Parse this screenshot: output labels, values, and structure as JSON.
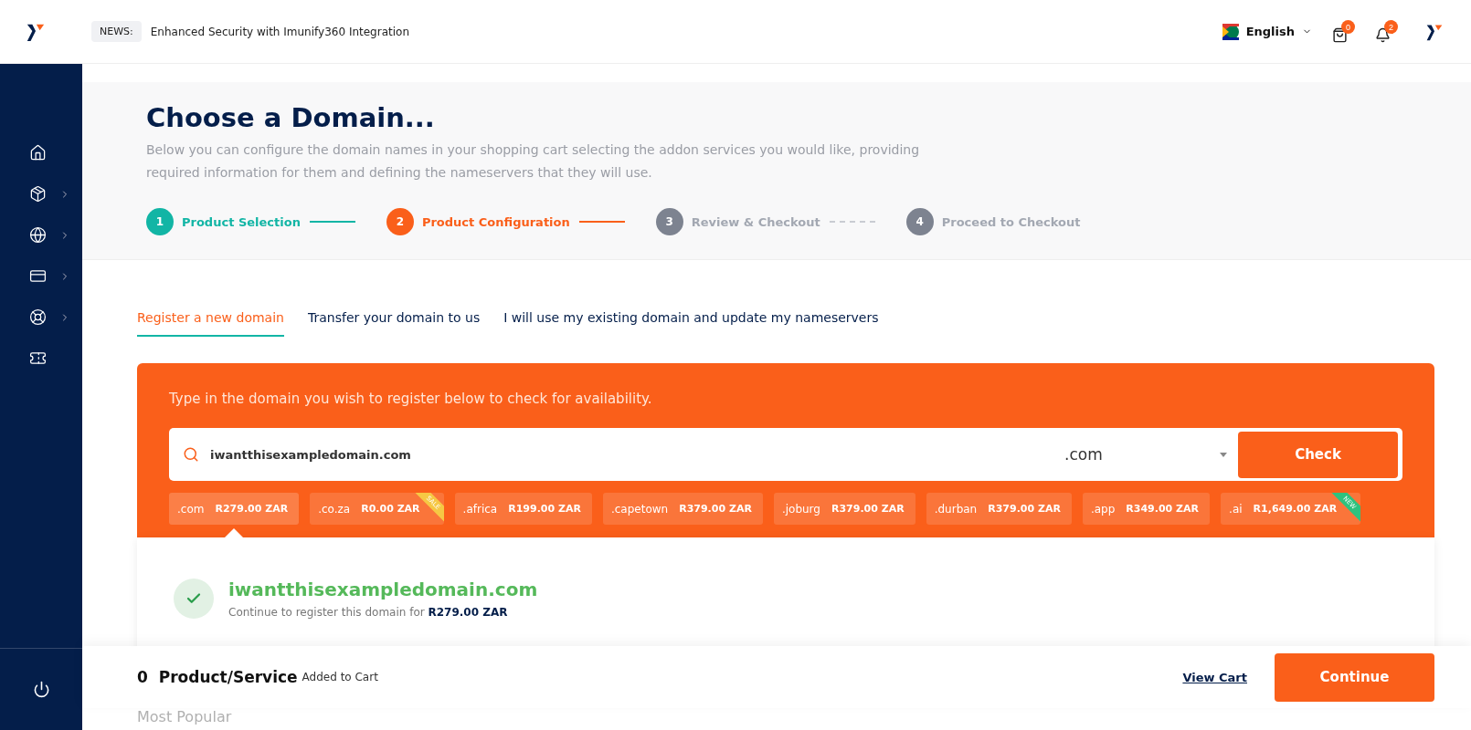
{
  "header": {
    "news_label": "NEWS:",
    "news_text": "Enhanced Security with Imunify360 Integration",
    "language": "English",
    "cart_count": "0",
    "notification_count": "2"
  },
  "sidebar": {
    "items": [
      {
        "kind": "home",
        "expandable": false
      },
      {
        "kind": "box",
        "expandable": true
      },
      {
        "kind": "globe",
        "expandable": true
      },
      {
        "kind": "card",
        "expandable": true
      },
      {
        "kind": "support",
        "expandable": true
      },
      {
        "kind": "ticket",
        "expandable": false
      }
    ]
  },
  "title": "Choose a Domain...",
  "description": "Below you can configure the domain names in your shopping cart selecting the addon services you would like, providing required information for them and defining the nameservers that they will use.",
  "steps": [
    {
      "number": "1",
      "label": "Product Selection",
      "completed": true,
      "active": false
    },
    {
      "number": "2",
      "label": "Product Configuration",
      "completed": false,
      "active": true
    },
    {
      "number": "3",
      "label": "Review & Checkout",
      "completed": false,
      "active": false
    },
    {
      "number": "4",
      "label": "Proceed to Checkout",
      "completed": false,
      "active": false
    }
  ],
  "tabs": [
    {
      "label": "Register a new domain",
      "selected": true
    },
    {
      "label": "Transfer your domain to us",
      "selected": false
    },
    {
      "label": "I will use my existing domain and update my nameservers",
      "selected": false
    }
  ],
  "search": {
    "prompt": "Type in the domain you wish to register below to check for availability.",
    "value": "iwantthisexampledomain.com",
    "tld": ".com",
    "button": "Check"
  },
  "tlds": [
    {
      "name": ".com",
      "price": "R279.00 ZAR",
      "selected": true
    },
    {
      "name": ".co.za",
      "price": "R0.00 ZAR",
      "selected": false,
      "ribbon": {
        "text": "SALE",
        "color": "#f6c844"
      }
    },
    {
      "name": ".africa",
      "price": "R199.00 ZAR",
      "selected": false
    },
    {
      "name": ".capetown",
      "price": "R379.00 ZAR",
      "selected": false
    },
    {
      "name": ".joburg",
      "price": "R379.00 ZAR",
      "selected": false
    },
    {
      "name": ".durban",
      "price": "R379.00 ZAR",
      "selected": false
    },
    {
      "name": ".app",
      "price": "R349.00 ZAR",
      "selected": false
    },
    {
      "name": ".ai",
      "price": "R1,649.00 ZAR",
      "selected": false,
      "ribbon": {
        "text": "NEW",
        "color": "#2ec27e"
      }
    }
  ],
  "result": {
    "domain": "iwantthisexampledomain.com",
    "message": "Continue to register this domain for **R279.00 ZAR**"
  },
  "section_heading": "Most Popular",
  "footer": {
    "count": "0",
    "label": "Product/Service",
    "suffix": "Added to Cart",
    "view_cart": "View Cart",
    "continue": "Continue"
  }
}
